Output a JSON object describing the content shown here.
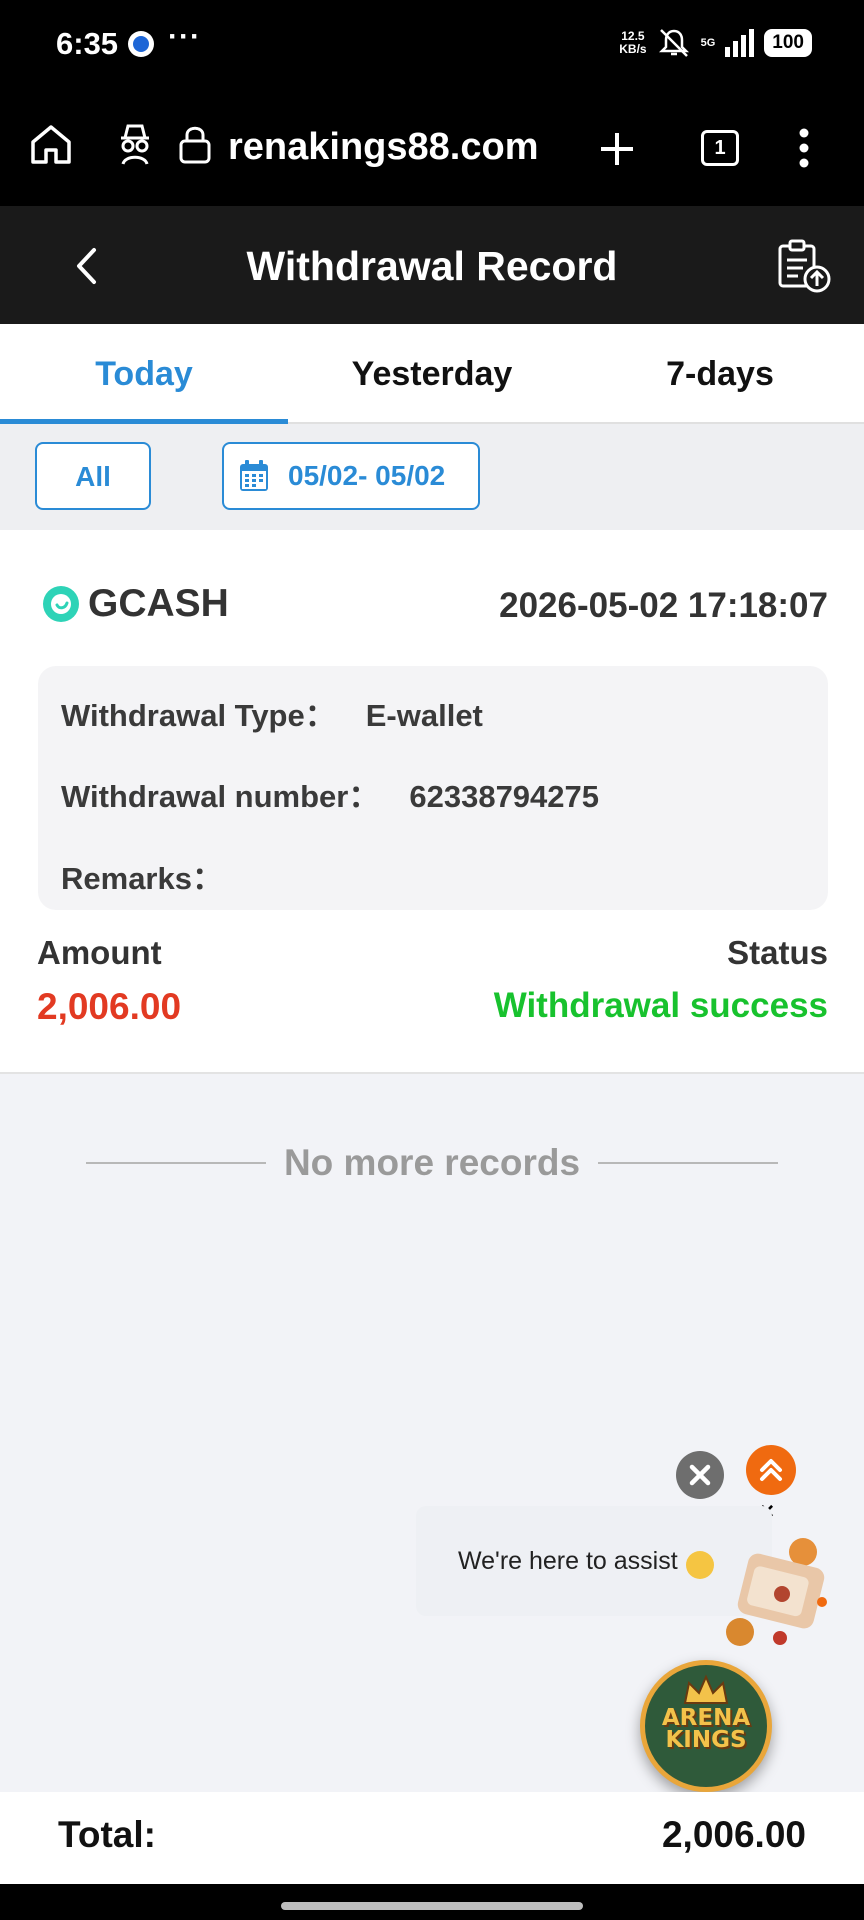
{
  "status_bar": {
    "time": "6:35",
    "dots": "···",
    "speed_value": "12.5",
    "speed_unit": "KB/s",
    "network": "5G",
    "battery": "100"
  },
  "browser": {
    "url": "renakings88.com",
    "tab_count": "1"
  },
  "header": {
    "title": "Withdrawal Record"
  },
  "tabs": [
    {
      "label": "Today",
      "active": true
    },
    {
      "label": "Yesterday",
      "active": false
    },
    {
      "label": "7-days",
      "active": false
    }
  ],
  "filters": {
    "all_label": "All",
    "date_range": "05/02- 05/02"
  },
  "record": {
    "method": "GCASH",
    "datetime": "2026-05-02 17:18:07",
    "type_label": "Withdrawal Type：",
    "type_value": "E-wallet",
    "number_label": "Withdrawal number：",
    "number_value": "62338794275",
    "remarks_label": "Remarks：",
    "remarks_value": "",
    "amount_label": "Amount",
    "amount_value": "2,006.00",
    "status_label": "Status",
    "status_value": "Withdrawal success"
  },
  "no_more": "No more records",
  "chat": {
    "close_x": "×",
    "message": "We're here to assist"
  },
  "arena_logo": "ARENA KINGS",
  "footer": {
    "total_label": "Total:",
    "total_value": "2,006.00"
  },
  "colors": {
    "accent": "#2a8bd6",
    "amount": "#e23a22",
    "success": "#18c22e",
    "gcash": "#2ed3b7",
    "scroll_top": "#f06a10"
  },
  "icons": [
    "home-icon",
    "incognito-icon",
    "lock-icon",
    "new-tab-icon",
    "tabs-icon",
    "more-icon",
    "back-icon",
    "export-record-icon",
    "calendar-icon",
    "gcash-logo-icon",
    "close-icon",
    "scroll-top-icon",
    "gift-icon"
  ]
}
